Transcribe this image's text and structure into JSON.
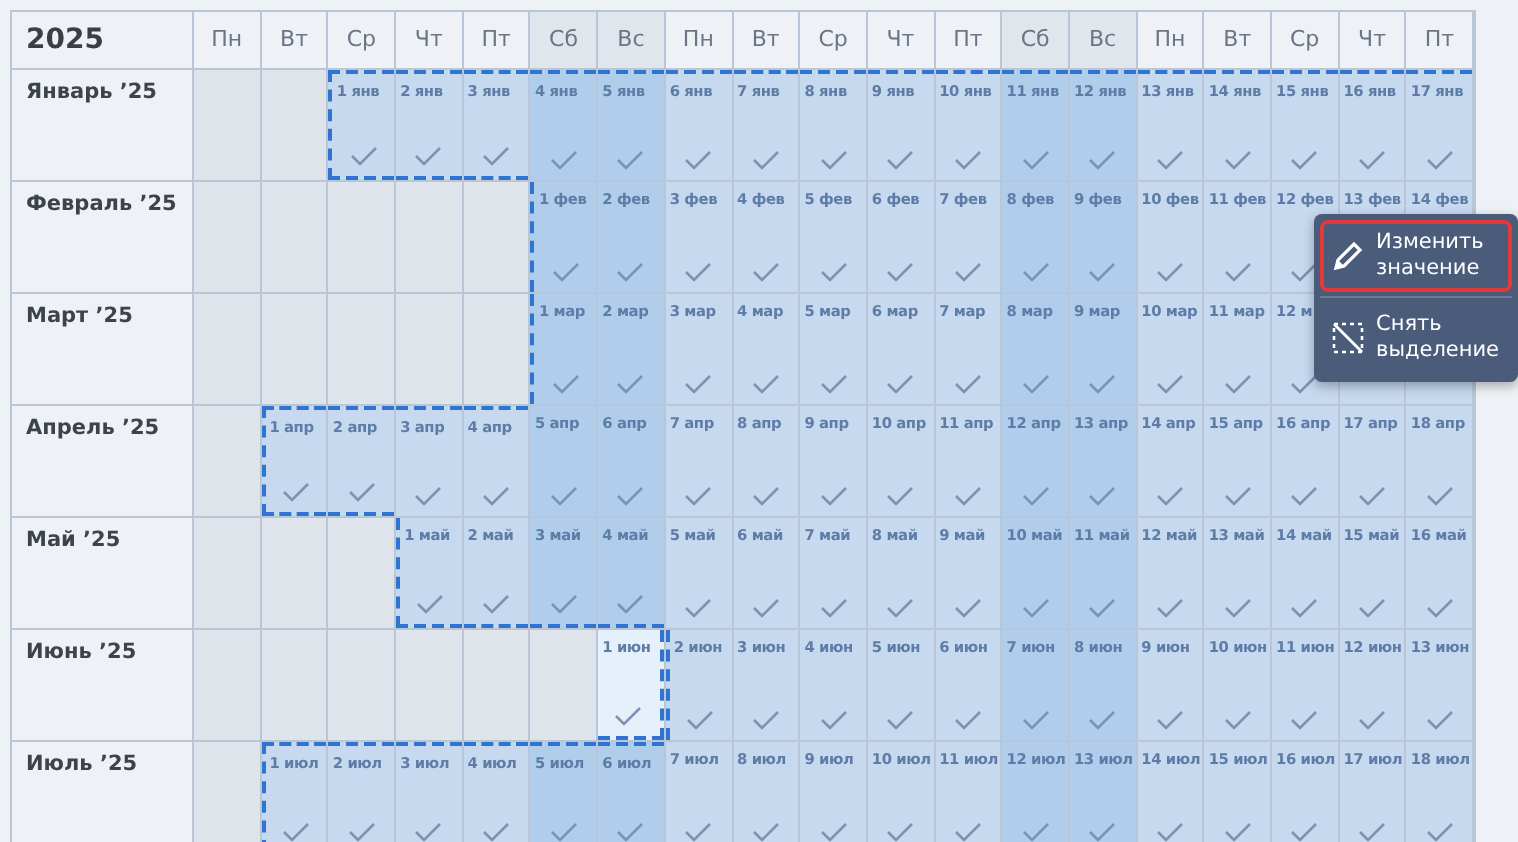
{
  "year": "2025",
  "weekdays": [
    {
      "label": "Пн",
      "weekend": false
    },
    {
      "label": "Вт",
      "weekend": false
    },
    {
      "label": "Ср",
      "weekend": false
    },
    {
      "label": "Чт",
      "weekend": false
    },
    {
      "label": "Пт",
      "weekend": false
    },
    {
      "label": "Сб",
      "weekend": true
    },
    {
      "label": "Вс",
      "weekend": true
    },
    {
      "label": "Пн",
      "weekend": false
    },
    {
      "label": "Вт",
      "weekend": false
    },
    {
      "label": "Ср",
      "weekend": false
    },
    {
      "label": "Чт",
      "weekend": false
    },
    {
      "label": "Пт",
      "weekend": false
    },
    {
      "label": "Сб",
      "weekend": true
    },
    {
      "label": "Вс",
      "weekend": true
    },
    {
      "label": "Пн",
      "weekend": false
    },
    {
      "label": "Вт",
      "weekend": false
    },
    {
      "label": "Ср",
      "weekend": false
    },
    {
      "label": "Чт",
      "weekend": false
    },
    {
      "label": "Пт",
      "weekend": false
    }
  ],
  "months": [
    {
      "label": "Январь ’25",
      "cells": [
        {
          "kind": "blank"
        },
        {
          "kind": "blank"
        },
        {
          "kind": "day",
          "label": "1 янв",
          "selected": true,
          "checked": true
        },
        {
          "kind": "day",
          "label": "2 янв",
          "selected": true,
          "checked": true
        },
        {
          "kind": "day",
          "label": "3 янв",
          "selected": true,
          "checked": true
        },
        {
          "kind": "day",
          "label": "4 янв",
          "selected": true,
          "checked": true
        },
        {
          "kind": "day",
          "label": "5 янв",
          "selected": true,
          "checked": true
        },
        {
          "kind": "day",
          "label": "6 янв",
          "selected": true,
          "checked": true
        },
        {
          "kind": "day",
          "label": "7 янв",
          "selected": true,
          "checked": true
        },
        {
          "kind": "day",
          "label": "8 янв",
          "selected": true,
          "checked": true
        },
        {
          "kind": "day",
          "label": "9 янв",
          "selected": true,
          "checked": true
        },
        {
          "kind": "day",
          "label": "10 янв",
          "selected": true,
          "checked": true
        },
        {
          "kind": "day",
          "label": "11 янв",
          "selected": true,
          "checked": true
        },
        {
          "kind": "day",
          "label": "12 янв",
          "selected": true,
          "checked": true
        },
        {
          "kind": "day",
          "label": "13 янв",
          "selected": true,
          "checked": true
        },
        {
          "kind": "day",
          "label": "14 янв",
          "selected": true,
          "checked": true
        },
        {
          "kind": "day",
          "label": "15 янв",
          "selected": true,
          "checked": true
        },
        {
          "kind": "day",
          "label": "16 янв",
          "selected": true,
          "checked": true
        },
        {
          "kind": "day",
          "label": "17 янв",
          "selected": true,
          "checked": true
        }
      ]
    },
    {
      "label": "Февраль ’25",
      "cells": [
        {
          "kind": "blank"
        },
        {
          "kind": "blank"
        },
        {
          "kind": "blank"
        },
        {
          "kind": "blank"
        },
        {
          "kind": "blank"
        },
        {
          "kind": "day",
          "label": "1 фев",
          "selected": true,
          "checked": true
        },
        {
          "kind": "day",
          "label": "2 фев",
          "selected": true,
          "checked": true
        },
        {
          "kind": "day",
          "label": "3 фев",
          "selected": true,
          "checked": true
        },
        {
          "kind": "day",
          "label": "4 фев",
          "selected": true,
          "checked": true
        },
        {
          "kind": "day",
          "label": "5 фев",
          "selected": true,
          "checked": true
        },
        {
          "kind": "day",
          "label": "6 фев",
          "selected": true,
          "checked": true
        },
        {
          "kind": "day",
          "label": "7 фев",
          "selected": true,
          "checked": true
        },
        {
          "kind": "day",
          "label": "8 фев",
          "selected": true,
          "checked": true
        },
        {
          "kind": "day",
          "label": "9 фев",
          "selected": true,
          "checked": true
        },
        {
          "kind": "day",
          "label": "10 фев",
          "selected": true,
          "checked": true
        },
        {
          "kind": "day",
          "label": "11 фев",
          "selected": true,
          "checked": true
        },
        {
          "kind": "day",
          "label": "12 фев",
          "selected": true,
          "checked": true
        },
        {
          "kind": "day",
          "label": "13 фев",
          "selected": true
        },
        {
          "kind": "day",
          "label": "14 фев",
          "selected": true
        }
      ]
    },
    {
      "label": "Март ’25",
      "cells": [
        {
          "kind": "blank"
        },
        {
          "kind": "blank"
        },
        {
          "kind": "blank"
        },
        {
          "kind": "blank"
        },
        {
          "kind": "blank"
        },
        {
          "kind": "day",
          "label": "1 мар",
          "selected": true,
          "checked": true
        },
        {
          "kind": "day",
          "label": "2 мар",
          "selected": true,
          "checked": true
        },
        {
          "kind": "day",
          "label": "3 мар",
          "selected": true,
          "checked": true
        },
        {
          "kind": "day",
          "label": "4 мар",
          "selected": true,
          "checked": true
        },
        {
          "kind": "day",
          "label": "5 мар",
          "selected": true,
          "checked": true
        },
        {
          "kind": "day",
          "label": "6 мар",
          "selected": true,
          "checked": true
        },
        {
          "kind": "day",
          "label": "7 мар",
          "selected": true,
          "checked": true
        },
        {
          "kind": "day",
          "label": "8 мар",
          "selected": true,
          "checked": true
        },
        {
          "kind": "day",
          "label": "9 мар",
          "selected": true,
          "checked": true
        },
        {
          "kind": "day",
          "label": "10 мар",
          "selected": true,
          "checked": true
        },
        {
          "kind": "day",
          "label": "11 мар",
          "selected": true,
          "checked": true
        },
        {
          "kind": "day",
          "label": "12 м",
          "selected": true,
          "checked": true
        },
        {
          "kind": "day",
          "selected": true
        },
        {
          "kind": "day",
          "selected": true
        }
      ]
    },
    {
      "label": "Апрель ’25",
      "cells": [
        {
          "kind": "blank"
        },
        {
          "kind": "day",
          "label": "1 апр",
          "selected": true,
          "checked": true
        },
        {
          "kind": "day",
          "label": "2 апр",
          "selected": true,
          "checked": true
        },
        {
          "kind": "day",
          "label": "3 апр",
          "selected": true,
          "checked": true
        },
        {
          "kind": "day",
          "label": "4 апр",
          "selected": true,
          "checked": true
        },
        {
          "kind": "day",
          "label": "5 апр",
          "selected": true,
          "checked": true
        },
        {
          "kind": "day",
          "label": "6 апр",
          "selected": true,
          "checked": true
        },
        {
          "kind": "day",
          "label": "7 апр",
          "selected": true,
          "checked": true
        },
        {
          "kind": "day",
          "label": "8 апр",
          "selected": true,
          "checked": true
        },
        {
          "kind": "day",
          "label": "9 апр",
          "selected": true,
          "checked": true
        },
        {
          "kind": "day",
          "label": "10 апр",
          "selected": true,
          "checked": true
        },
        {
          "kind": "day",
          "label": "11 апр",
          "selected": true,
          "checked": true
        },
        {
          "kind": "day",
          "label": "12 апр",
          "selected": true,
          "checked": true
        },
        {
          "kind": "day",
          "label": "13 апр",
          "selected": true,
          "checked": true
        },
        {
          "kind": "day",
          "label": "14 апр",
          "selected": true,
          "checked": true
        },
        {
          "kind": "day",
          "label": "15 апр",
          "selected": true,
          "checked": true
        },
        {
          "kind": "day",
          "label": "16 апр",
          "selected": true,
          "checked": true
        },
        {
          "kind": "day",
          "label": "17 апр",
          "selected": true,
          "checked": true
        },
        {
          "kind": "day",
          "label": "18 апр",
          "selected": true,
          "checked": true
        }
      ]
    },
    {
      "label": "Май ’25",
      "cells": [
        {
          "kind": "blank"
        },
        {
          "kind": "blank"
        },
        {
          "kind": "blank"
        },
        {
          "kind": "day",
          "label": "1 май",
          "selected": true,
          "checked": true
        },
        {
          "kind": "day",
          "label": "2 май",
          "selected": true,
          "checked": true
        },
        {
          "kind": "day",
          "label": "3 май",
          "selected": true,
          "checked": true
        },
        {
          "kind": "day",
          "label": "4 май",
          "selected": true,
          "checked": true
        },
        {
          "kind": "day",
          "label": "5 май",
          "selected": true,
          "checked": true
        },
        {
          "kind": "day",
          "label": "6 май",
          "selected": true,
          "checked": true
        },
        {
          "kind": "day",
          "label": "7 май",
          "selected": true,
          "checked": true
        },
        {
          "kind": "day",
          "label": "8 май",
          "selected": true,
          "checked": true
        },
        {
          "kind": "day",
          "label": "9 май",
          "selected": true,
          "checked": true
        },
        {
          "kind": "day",
          "label": "10 май",
          "selected": true,
          "checked": true
        },
        {
          "kind": "day",
          "label": "11 май",
          "selected": true,
          "checked": true
        },
        {
          "kind": "day",
          "label": "12 май",
          "selected": true,
          "checked": true
        },
        {
          "kind": "day",
          "label": "13 май",
          "selected": true,
          "checked": true
        },
        {
          "kind": "day",
          "label": "14 май",
          "selected": true,
          "checked": true
        },
        {
          "kind": "day",
          "label": "15 май",
          "selected": true,
          "checked": true
        },
        {
          "kind": "day",
          "label": "16 май",
          "selected": true,
          "checked": true
        }
      ]
    },
    {
      "label": "Июнь ’25",
      "cells": [
        {
          "kind": "blank"
        },
        {
          "kind": "blank"
        },
        {
          "kind": "blank"
        },
        {
          "kind": "blank"
        },
        {
          "kind": "blank"
        },
        {
          "kind": "blank"
        },
        {
          "kind": "day",
          "label": "1 июн",
          "selected": false,
          "checked": true
        },
        {
          "kind": "day",
          "label": "2 июн",
          "selected": true,
          "checked": true
        },
        {
          "kind": "day",
          "label": "3 июн",
          "selected": true,
          "checked": true
        },
        {
          "kind": "day",
          "label": "4 июн",
          "selected": true,
          "checked": true
        },
        {
          "kind": "day",
          "label": "5 июн",
          "selected": true,
          "checked": true
        },
        {
          "kind": "day",
          "label": "6 июн",
          "selected": true,
          "checked": true
        },
        {
          "kind": "day",
          "label": "7 июн",
          "selected": true,
          "checked": true
        },
        {
          "kind": "day",
          "label": "8 июн",
          "selected": true,
          "checked": true
        },
        {
          "kind": "day",
          "label": "9 июн",
          "selected": true,
          "checked": true
        },
        {
          "kind": "day",
          "label": "10 июн",
          "selected": true,
          "checked": true
        },
        {
          "kind": "day",
          "label": "11 июн",
          "selected": true,
          "checked": true
        },
        {
          "kind": "day",
          "label": "12 июн",
          "selected": true,
          "checked": true
        },
        {
          "kind": "day",
          "label": "13 июн",
          "selected": true,
          "checked": true
        }
      ]
    },
    {
      "label": "Июль ’25",
      "cells": [
        {
          "kind": "blank"
        },
        {
          "kind": "day",
          "label": "1 июл",
          "selected": true,
          "checked": true
        },
        {
          "kind": "day",
          "label": "2 июл",
          "selected": true,
          "checked": true
        },
        {
          "kind": "day",
          "label": "3 июл",
          "selected": true,
          "checked": true
        },
        {
          "kind": "day",
          "label": "4 июл",
          "selected": true,
          "checked": true
        },
        {
          "kind": "day",
          "label": "5 июл",
          "selected": true,
          "checked": true
        },
        {
          "kind": "day",
          "label": "6 июл",
          "selected": true,
          "checked": true
        },
        {
          "kind": "day",
          "label": "7 июл",
          "selected": true,
          "checked": true
        },
        {
          "kind": "day",
          "label": "8 июл",
          "selected": true,
          "checked": true
        },
        {
          "kind": "day",
          "label": "9 июл",
          "selected": true,
          "checked": true
        },
        {
          "kind": "day",
          "label": "10 июл",
          "selected": true,
          "checked": true
        },
        {
          "kind": "day",
          "label": "11 июл",
          "selected": true,
          "checked": true
        },
        {
          "kind": "day",
          "label": "12 июл",
          "selected": true,
          "checked": true
        },
        {
          "kind": "day",
          "label": "13 июл",
          "selected": true,
          "checked": true
        },
        {
          "kind": "day",
          "label": "14 июл",
          "selected": true,
          "checked": true
        },
        {
          "kind": "day",
          "label": "15 июл",
          "selected": true,
          "checked": true
        },
        {
          "kind": "day",
          "label": "16 июл",
          "selected": true,
          "checked": true
        },
        {
          "kind": "day",
          "label": "17 июл",
          "selected": true,
          "checked": true
        },
        {
          "kind": "day",
          "label": "18 июл",
          "selected": true,
          "checked": true
        }
      ]
    }
  ],
  "context_menu": [
    {
      "kind": "edit",
      "label": "Изменить значение",
      "selected": true
    },
    {
      "kind": "clear",
      "label": "Снять выделение",
      "selected": false
    }
  ]
}
